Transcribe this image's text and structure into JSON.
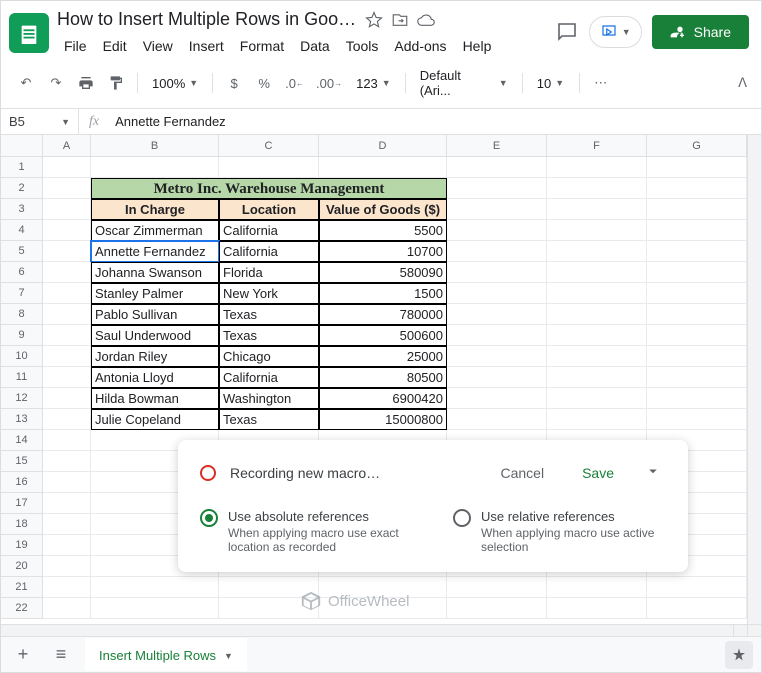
{
  "doc": {
    "title": "How to Insert Multiple Rows in Google ..."
  },
  "menu": {
    "file": "File",
    "edit": "Edit",
    "view": "View",
    "insert": "Insert",
    "format": "Format",
    "data": "Data",
    "tools": "Tools",
    "addons": "Add-ons",
    "help": "Help"
  },
  "share": {
    "label": "Share"
  },
  "toolbar": {
    "zoom": "100%",
    "currency": "$",
    "percent": "%",
    "dec_dec": ".0",
    "dec_inc": ".00",
    "numfmt": "123",
    "font": "Default (Ari...",
    "fontsize": "10"
  },
  "formula": {
    "namebox": "B5",
    "fx": "fx",
    "value": "Annette Fernandez"
  },
  "cols": [
    "A",
    "B",
    "C",
    "D",
    "E",
    "F",
    "G"
  ],
  "rows": [
    "1",
    "2",
    "3",
    "4",
    "5",
    "6",
    "7",
    "8",
    "9",
    "10",
    "11",
    "12",
    "13",
    "14",
    "15",
    "16",
    "17",
    "18",
    "19",
    "20",
    "21",
    "22"
  ],
  "table": {
    "title": "Metro Inc. Warehouse Management",
    "h1": "In Charge",
    "h2": "Location",
    "h3": "Value of Goods ($)",
    "r": [
      {
        "b": "Oscar Zimmerman",
        "c": "California",
        "d": "5500"
      },
      {
        "b": "Annette Fernandez",
        "c": "California",
        "d": "10700"
      },
      {
        "b": "Johanna Swanson",
        "c": "Florida",
        "d": "580090"
      },
      {
        "b": "Stanley Palmer",
        "c": "New York",
        "d": "1500"
      },
      {
        "b": "Pablo Sullivan",
        "c": "Texas",
        "d": "780000"
      },
      {
        "b": "Saul Underwood",
        "c": "Texas",
        "d": "500600"
      },
      {
        "b": "Jordan Riley",
        "c": "Chicago",
        "d": "25000"
      },
      {
        "b": "Antonia Lloyd",
        "c": "California",
        "d": "80500"
      },
      {
        "b": "Hilda Bowman",
        "c": "Washington",
        "d": "6900420"
      },
      {
        "b": "Julie Copeland",
        "c": "Texas",
        "d": "15000800"
      }
    ]
  },
  "macro": {
    "title": "Recording new macro…",
    "cancel": "Cancel",
    "save": "Save",
    "opt1t": "Use absolute references",
    "opt1d": "When applying macro use exact location as recorded",
    "opt2t": "Use relative references",
    "opt2d": "When applying macro use active selection"
  },
  "sheet": {
    "tab": "Insert Multiple Rows"
  },
  "watermark": "OfficeWheel"
}
